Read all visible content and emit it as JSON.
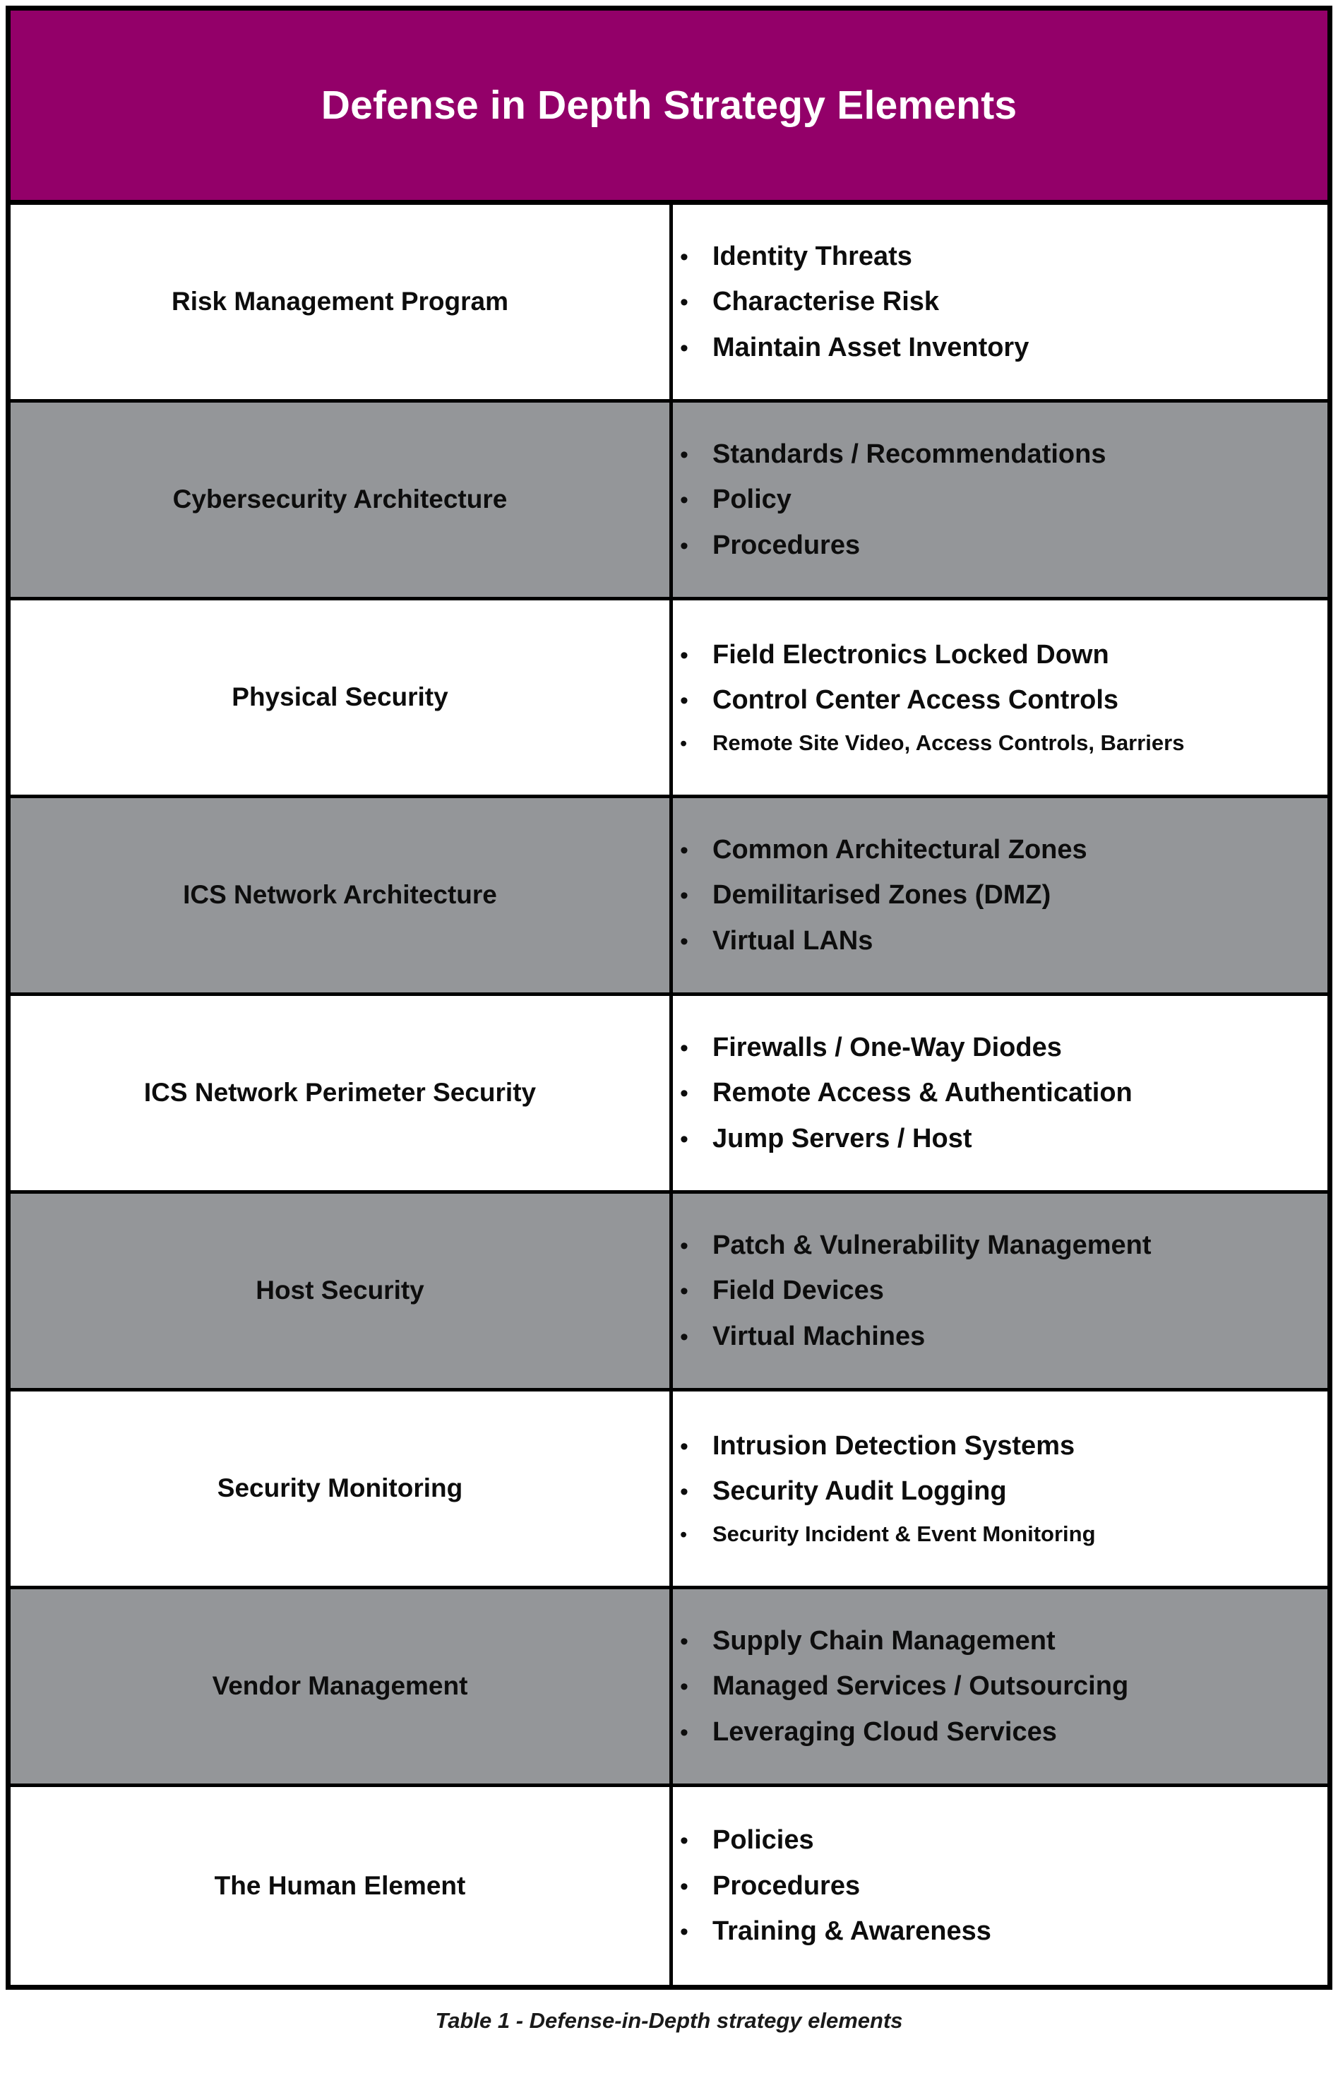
{
  "header": {
    "title": "Defense in Depth Strategy Elements",
    "background_color": "#930069",
    "text_color": "#ffffff"
  },
  "colors": {
    "accent_magenta": "#930069",
    "shaded_row": "#949699",
    "plain_row": "#ffffff",
    "border": "#000000",
    "text": "#0d0d0d"
  },
  "table": {
    "bullet_glyph": "•",
    "rows": [
      {
        "label": "Risk Management Program",
        "shaded": false,
        "items": [
          {
            "text": "Identity Threats",
            "small": false
          },
          {
            "text": "Characterise Risk",
            "small": false
          },
          {
            "text": "Maintain Asset Inventory",
            "small": false
          }
        ]
      },
      {
        "label": "Cybersecurity Architecture",
        "shaded": true,
        "items": [
          {
            "text": "Standards / Recommendations",
            "small": false
          },
          {
            "text": "Policy",
            "small": false
          },
          {
            "text": "Procedures",
            "small": false
          }
        ]
      },
      {
        "label": "Physical Security",
        "shaded": false,
        "items": [
          {
            "text": "Field Electronics Locked Down",
            "small": false
          },
          {
            "text": "Control Center Access Controls",
            "small": false
          },
          {
            "text": "Remote Site Video, Access Controls, Barriers",
            "small": true
          }
        ]
      },
      {
        "label": "ICS Network Architecture",
        "shaded": true,
        "items": [
          {
            "text": "Common Architectural Zones",
            "small": false
          },
          {
            "text": "Demilitarised Zones (DMZ)",
            "small": false
          },
          {
            "text": "Virtual LANs",
            "small": false
          }
        ]
      },
      {
        "label": "ICS Network Perimeter Security",
        "shaded": false,
        "items": [
          {
            "text": "Firewalls / One-Way Diodes",
            "small": false
          },
          {
            "text": "Remote Access & Authentication",
            "small": false
          },
          {
            "text": "Jump Servers / Host",
            "small": false
          }
        ]
      },
      {
        "label": "Host Security",
        "shaded": true,
        "items": [
          {
            "text": "Patch & Vulnerability Management",
            "small": false
          },
          {
            "text": "Field Devices",
            "small": false
          },
          {
            "text": "Virtual Machines",
            "small": false
          }
        ]
      },
      {
        "label": "Security Monitoring",
        "shaded": false,
        "items": [
          {
            "text": "Intrusion Detection Systems",
            "small": false
          },
          {
            "text": "Security Audit Logging",
            "small": false
          },
          {
            "text": "Security Incident & Event Monitoring",
            "small": true
          }
        ]
      },
      {
        "label": "Vendor Management",
        "shaded": true,
        "items": [
          {
            "text": "Supply Chain Management",
            "small": false
          },
          {
            "text": "Managed Services / Outsourcing",
            "small": false
          },
          {
            "text": "Leveraging Cloud Services",
            "small": false
          }
        ]
      },
      {
        "label": "The Human Element",
        "shaded": false,
        "items": [
          {
            "text": "Policies",
            "small": false
          },
          {
            "text": "Procedures",
            "small": false
          },
          {
            "text": "Training & Awareness",
            "small": false
          }
        ]
      }
    ]
  },
  "caption": {
    "text": "Table 1 - Defense-in-Depth strategy elements"
  }
}
